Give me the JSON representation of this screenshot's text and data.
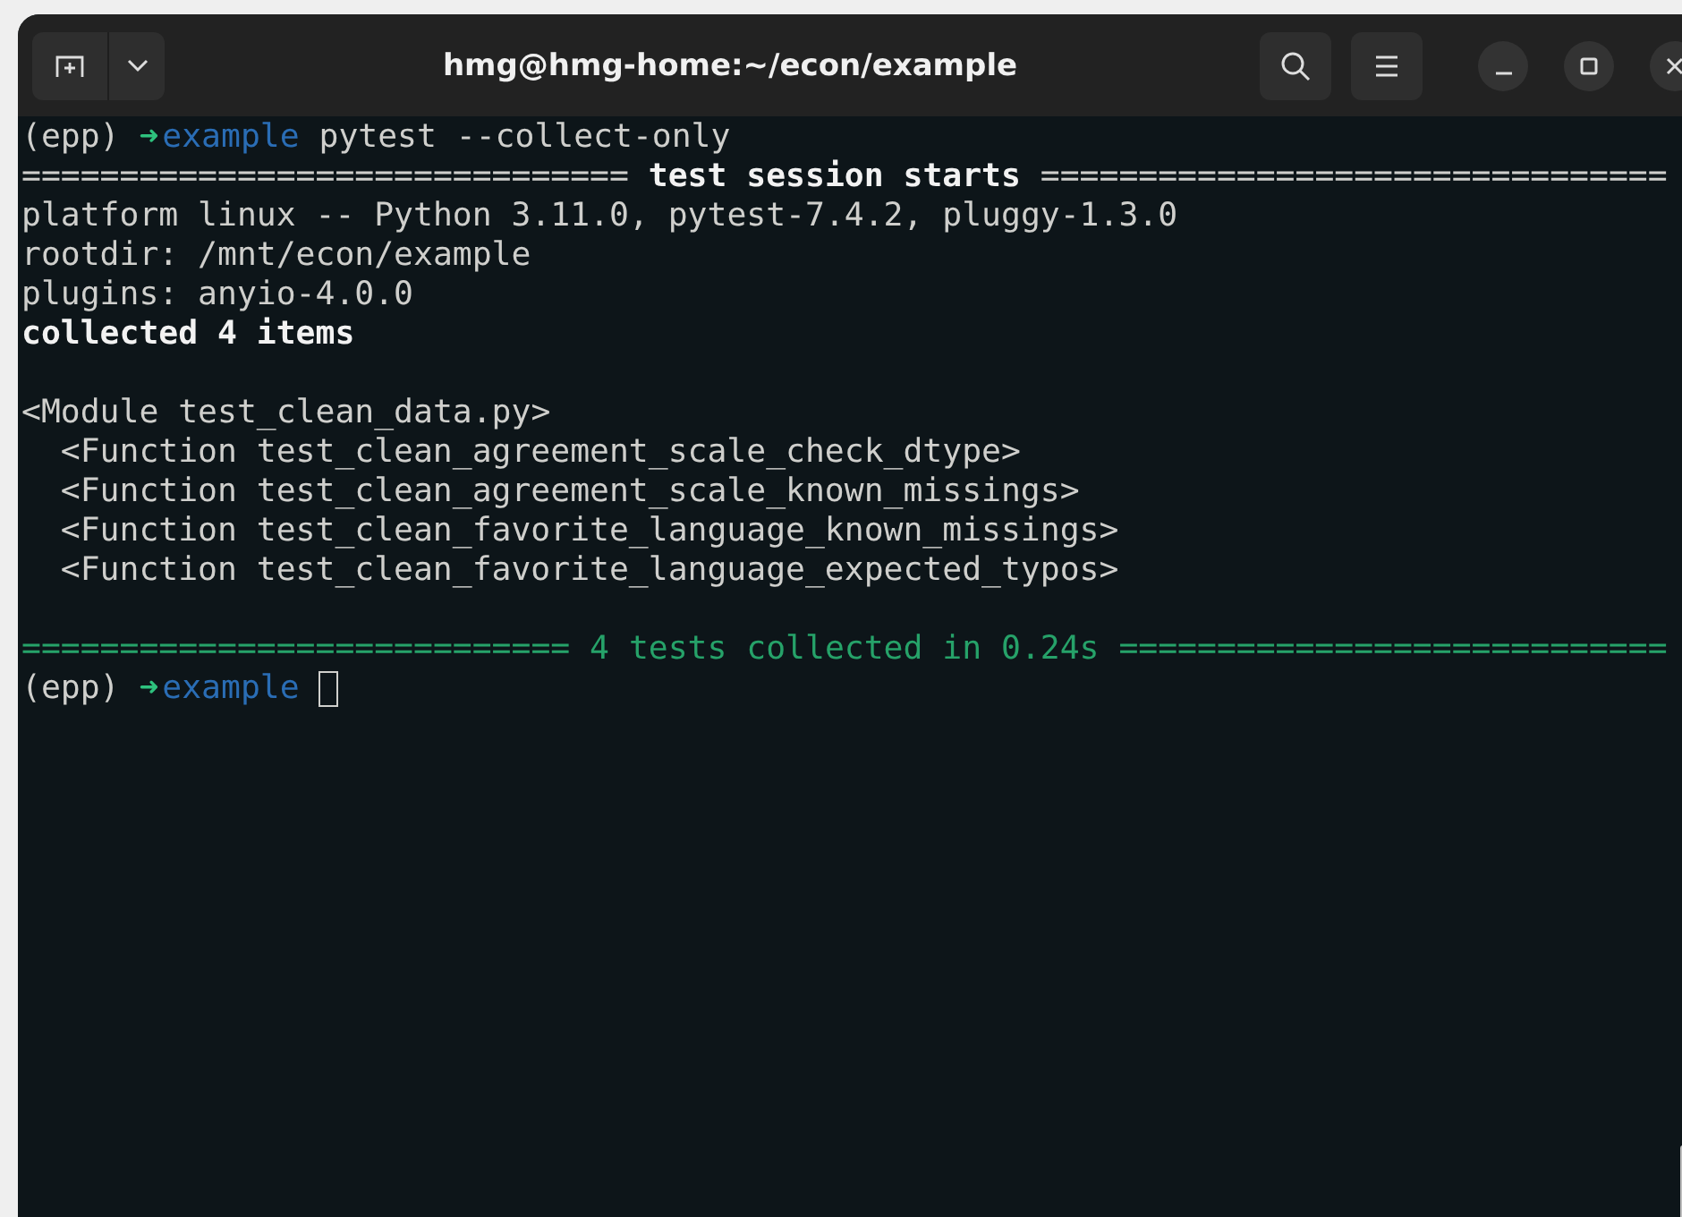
{
  "window": {
    "title": "hmg@hmg-home:~/econ/example"
  },
  "blocks": [
    [
      {
        "segments": [
          {
            "kind": "plain",
            "text": "(epp) "
          },
          {
            "kind": "arrow",
            "text": "➜"
          },
          {
            "kind": "dir",
            "text": "example"
          },
          {
            "kind": "plain",
            "text": " pytest --collect-only"
          }
        ]
      },
      {
        "segments": [
          {
            "kind": "plain",
            "text": "=============================== "
          },
          {
            "kind": "bold",
            "text": "test session starts"
          },
          {
            "kind": "plain",
            "text": " ================================"
          }
        ]
      },
      {
        "segments": [
          {
            "kind": "plain",
            "text": "platform linux -- Python 3.11.0, pytest-7.4.2, pluggy-1.3.0"
          }
        ]
      },
      {
        "segments": [
          {
            "kind": "plain",
            "text": "rootdir: /mnt/econ/example"
          }
        ]
      },
      {
        "segments": [
          {
            "kind": "plain",
            "text": "plugins: anyio-4.0.0"
          }
        ]
      },
      {
        "segments": [
          {
            "kind": "bold",
            "text": "collected 4 items"
          }
        ]
      }
    ],
    [
      {
        "segments": [
          {
            "kind": "plain",
            "text": "<Module test_clean_data.py>"
          }
        ],
        "children": [
          {
            "segments": [
              {
                "kind": "plain",
                "text": "<Function test_clean_agreement_scale_check_dtype>"
              }
            ]
          },
          {
            "segments": [
              {
                "kind": "plain",
                "text": "<Function test_clean_agreement_scale_known_missings>"
              }
            ]
          },
          {
            "segments": [
              {
                "kind": "plain",
                "text": "<Function test_clean_favorite_language_known_missings>"
              }
            ]
          },
          {
            "segments": [
              {
                "kind": "plain",
                "text": "<Function test_clean_favorite_language_expected_typos>"
              }
            ]
          }
        ]
      }
    ],
    [
      {
        "segments": [
          {
            "kind": "green",
            "text": "============================ 4 tests collected in 0.24s ============================"
          }
        ]
      },
      {
        "segments": [
          {
            "kind": "plain",
            "text": "(epp) "
          },
          {
            "kind": "arrow",
            "text": "➜"
          },
          {
            "kind": "dir",
            "text": "example"
          }
        ],
        "cursor": true
      }
    ]
  ]
}
